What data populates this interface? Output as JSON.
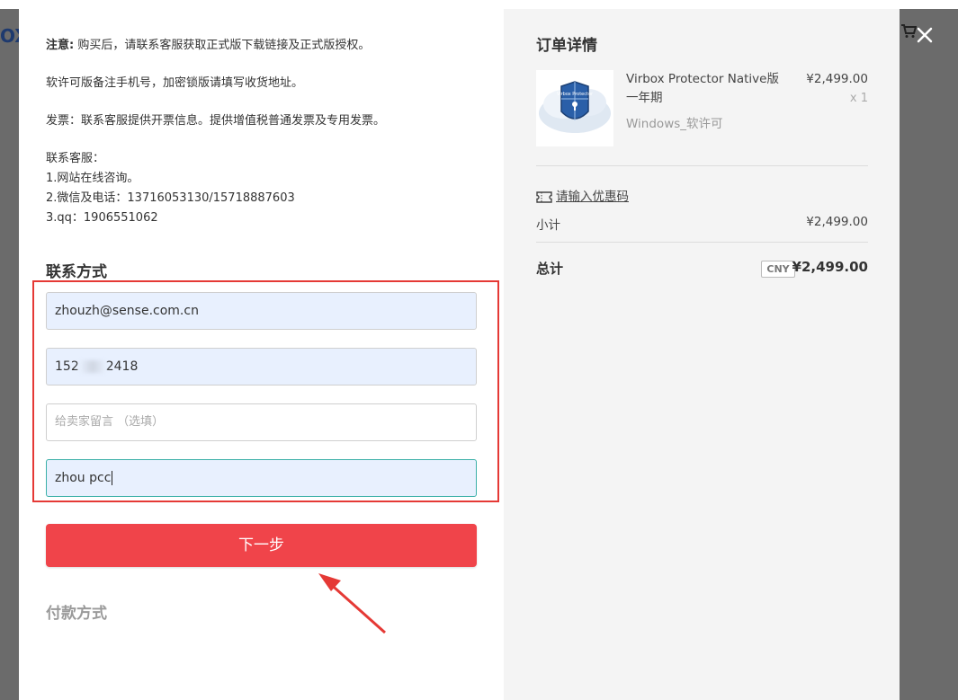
{
  "background": {
    "logo_fragment": "OX",
    "cart_icon": "shopping-cart-icon",
    "close_icon": "close-icon"
  },
  "notice": {
    "line1_prefix": "注意:",
    "line1_text": " 购买后，请联系客服获取正式版下载链接及正式版授权。",
    "line2": "软许可版备注手机号，加密锁版请填写收货地址。",
    "line3": "发票：联系客服提供开票信息。提供增值税普通发票及专用发票。",
    "contact_heading": "联系客服：",
    "contact_1": "1.网站在线咨询。",
    "contact_2": "2.微信及电话：13716053130/15718887603",
    "contact_3": "3.qq：1906551062"
  },
  "contact_section": {
    "title": "联系方式",
    "email_value": "zhouzh@sense.com.cn",
    "phone_prefix": "152",
    "phone_suffix": "2418",
    "message_placeholder": "给卖家留言 （选填）",
    "name_value": "zhou pcc"
  },
  "next_button_label": "下一步",
  "payment_section_title": "付款方式",
  "order": {
    "title": "订单详情",
    "product_name": "Virbox Protector Native版 一年期",
    "product_price": "¥2,499.00",
    "product_qty": "x 1",
    "product_variant": "Windows_软许可",
    "thumbnail_text": "Virbox Protector",
    "coupon_label": "请输入优惠码",
    "subtotal_label": "小计",
    "subtotal_value": "¥2,499.00",
    "total_label": "总计",
    "currency": "CNY",
    "total_value": "¥2,499.00"
  },
  "colors": {
    "accent_red": "#f0444a",
    "highlight_border": "#e53935",
    "autofill_bg": "#e8f0fe"
  }
}
